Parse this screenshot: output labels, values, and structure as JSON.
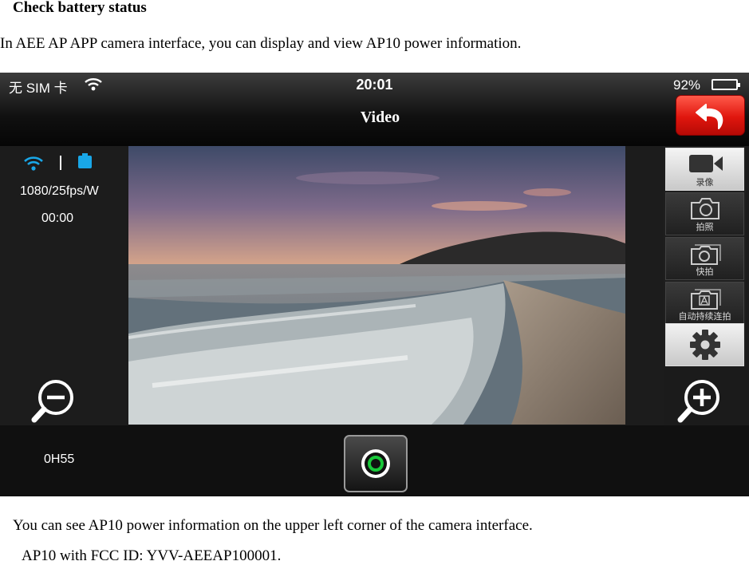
{
  "document": {
    "heading": "Check battery status",
    "intro": "In AEE AP APP camera interface, you can display and view AP10 power information.",
    "caption": "You can see AP10 power information on the upper left corner of the camera interface.",
    "fcc": "AP10 with FCC ID: YVV-AEEAP100001."
  },
  "status_bar": {
    "carrier": "无 SIM 卡",
    "time": "20:01",
    "battery_percent": "92%"
  },
  "camera": {
    "title": "Video",
    "back_icon": "undo-arrow-icon",
    "info": {
      "wifi_icon": "wifi-icon",
      "battery_icon": "battery-icon",
      "resolution": "1080/25fps/W",
      "record_time": "00:00"
    },
    "battery_remaining": "0H55",
    "modes": [
      {
        "label": "录像",
        "icon": "video-camera-icon",
        "active": true
      },
      {
        "label": "拍照",
        "icon": "photo-camera-icon",
        "active": false
      },
      {
        "label": "快拍",
        "icon": "burst-camera-icon",
        "active": false
      },
      {
        "label": "自动持续连拍",
        "icon": "auto-burst-camera-icon",
        "active": false
      }
    ],
    "settings_icon": "gear-icon",
    "zoom_out_icon": "zoom-out-icon",
    "zoom_in_icon": "zoom-in-icon",
    "shutter_icon": "record-button-icon",
    "colors": {
      "back_button": "#e0160e",
      "battery_indicator": "#19a7e8",
      "record_ring": "#19c83a"
    }
  }
}
